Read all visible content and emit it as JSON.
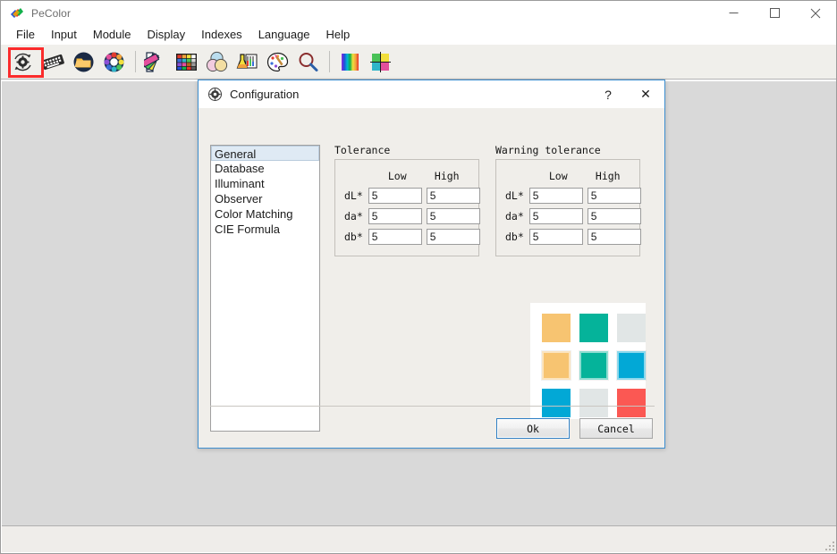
{
  "window": {
    "title": "PeColor",
    "icon": "pecolor-logo-icon",
    "controls": {
      "minimize": "minimize-icon",
      "maximize": "maximize-icon",
      "close": "close-icon"
    }
  },
  "menubar": {
    "items": [
      {
        "label": "File"
      },
      {
        "label": "Input"
      },
      {
        "label": "Module"
      },
      {
        "label": "Display"
      },
      {
        "label": "Indexes"
      },
      {
        "label": "Language"
      },
      {
        "label": "Help"
      }
    ]
  },
  "toolbar": {
    "highlighted_index": 0,
    "buttons": [
      {
        "icon": "settings-gear-refresh-icon",
        "highlighted": true
      },
      {
        "icon": "keyboard-icon"
      },
      {
        "icon": "open-folder-icon"
      },
      {
        "icon": "color-wheel-icon"
      },
      {
        "separator": true
      },
      {
        "icon": "color-fan-deck-icon"
      },
      {
        "icon": "color-chart-grid-icon"
      },
      {
        "icon": "venn-color-mix-icon"
      },
      {
        "icon": "lab-flask-icon"
      },
      {
        "icon": "artist-palette-icon"
      },
      {
        "icon": "magnifier-search-icon"
      },
      {
        "separator": true
      },
      {
        "icon": "spectrum-bars-icon"
      },
      {
        "icon": "color-space-grid-icon"
      }
    ]
  },
  "dialog": {
    "title": "Configuration",
    "icon": "settings-gear-icon",
    "help_label": "?",
    "close_label": "✕",
    "categories": {
      "selected": "General",
      "items": [
        {
          "label": "General"
        },
        {
          "label": "Database"
        },
        {
          "label": "Illuminant"
        },
        {
          "label": "Observer"
        },
        {
          "label": "Color Matching"
        },
        {
          "label": "CIE Formula"
        }
      ]
    },
    "tolerance": {
      "title": "Tolerance",
      "columns": [
        "Low",
        "High"
      ],
      "rows": [
        {
          "label": "dL*",
          "low": "5",
          "high": "5"
        },
        {
          "label": "da*",
          "low": "5",
          "high": "5"
        },
        {
          "label": "db*",
          "low": "5",
          "high": "5"
        }
      ]
    },
    "warning_tolerance": {
      "title": "Warning tolerance",
      "columns": [
        "Low",
        "High"
      ],
      "rows": [
        {
          "label": "dL*",
          "low": "5",
          "high": "5"
        },
        {
          "label": "da*",
          "low": "5",
          "high": "5"
        },
        {
          "label": "db*",
          "low": "5",
          "high": "5"
        }
      ]
    },
    "swatches": {
      "rows": [
        [
          {
            "name": "swatch-amber",
            "color": "#f7c471",
            "outlined": false
          },
          {
            "name": "swatch-teal",
            "color": "#05b39a",
            "outlined": false
          },
          {
            "name": "swatch-light-gray",
            "color": "#e1e6e6",
            "outlined": false
          }
        ],
        [
          {
            "name": "swatch-amber-outlined",
            "color": "#f7c471",
            "outlined": true
          },
          {
            "name": "swatch-teal-outlined",
            "color": "#05b39a",
            "outlined": true
          },
          {
            "name": "swatch-cyan-outlined",
            "color": "#02a8d6",
            "outlined": true
          }
        ],
        [
          {
            "name": "swatch-cyan",
            "color": "#02a8d6",
            "outlined": false
          },
          {
            "name": "swatch-light-gray-2",
            "color": "#e1e6e6",
            "outlined": false
          },
          {
            "name": "swatch-red",
            "color": "#fb5853",
            "outlined": false
          }
        ]
      ]
    },
    "buttons": {
      "ok": "Ok",
      "cancel": "Cancel"
    }
  },
  "colors": {
    "accent": "#3e8fd0",
    "highlight": "#fb2c2c",
    "dialog_bg": "#f0eeea",
    "client_bg": "#d9d9d9",
    "toolbar_bg": "#f0efeb"
  }
}
